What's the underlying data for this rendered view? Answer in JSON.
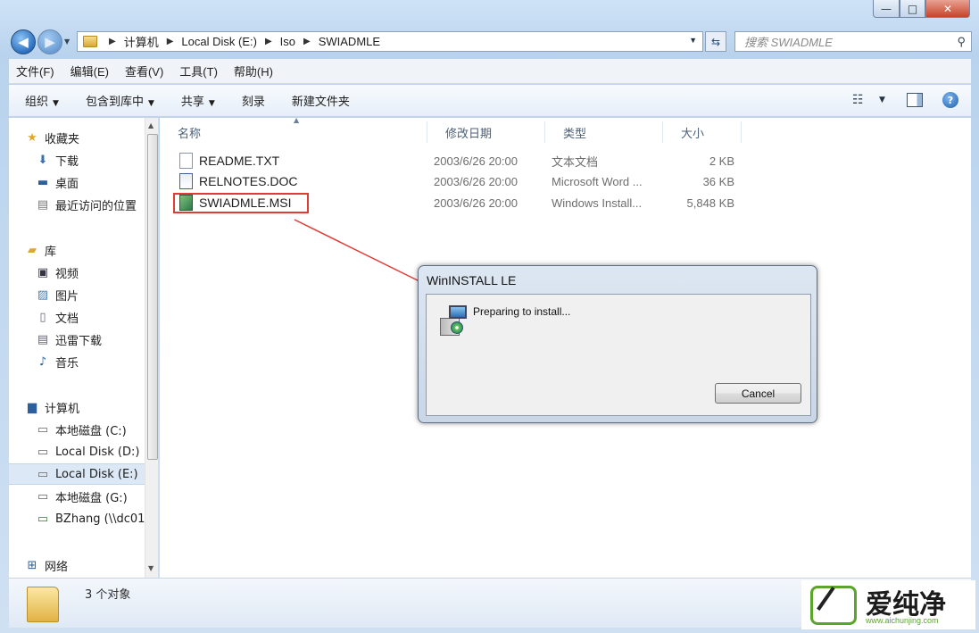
{
  "window": {
    "controls": {
      "minimize": "—",
      "maximize": "□",
      "close": "✕"
    }
  },
  "address": {
    "crumbs": [
      "计算机",
      "Local Disk (E:)",
      "Iso",
      "SWIADMLE"
    ],
    "search_placeholder": "搜索 SWIADMLE"
  },
  "menu": [
    "文件(F)",
    "编辑(E)",
    "查看(V)",
    "工具(T)",
    "帮助(H)"
  ],
  "toolbar": {
    "organize": "组织",
    "include_library": "包含到库中",
    "share": "共享",
    "burn": "刻录",
    "new_folder": "新建文件夹"
  },
  "nav": {
    "favorites": {
      "label": "收藏夹",
      "items": [
        "下载",
        "桌面",
        "最近访问的位置"
      ]
    },
    "libraries": {
      "label": "库",
      "items": [
        "视频",
        "图片",
        "文档",
        "迅雷下载",
        "音乐"
      ]
    },
    "computer": {
      "label": "计算机",
      "items": [
        "本地磁盘 (C:)",
        "Local Disk (D:)",
        "Local Disk (E:)",
        "本地磁盘 (G:)",
        "BZhang (\\\\dc01"
      ]
    },
    "network": {
      "label": "网络"
    },
    "selected": "Local Disk (E:)"
  },
  "columns": {
    "name": "名称",
    "date": "修改日期",
    "type": "类型",
    "size": "大小"
  },
  "files": [
    {
      "name": "README.TXT",
      "date": "2003/6/26 20:00",
      "type": "文本文档",
      "size": "2 KB",
      "icon": "text-file-icon"
    },
    {
      "name": "RELNOTES.DOC",
      "date": "2003/6/26 20:00",
      "type": "Microsoft Word ...",
      "size": "36 KB",
      "icon": "word-doc-icon"
    },
    {
      "name": "SWIADMLE.MSI",
      "date": "2003/6/26 20:00",
      "type": "Windows Install...",
      "size": "5,848 KB",
      "icon": "msi-installer-icon"
    }
  ],
  "status": {
    "count": "3 个对象"
  },
  "dialog": {
    "title": "WinINSTALL LE",
    "message": "Preparing to install...",
    "cancel": "Cancel"
  },
  "watermark": {
    "brand": "爱纯净",
    "url": "www.aichunjing.com"
  },
  "colors": {
    "highlight": "#e23a34",
    "watermark_green": "#5aa62a"
  }
}
